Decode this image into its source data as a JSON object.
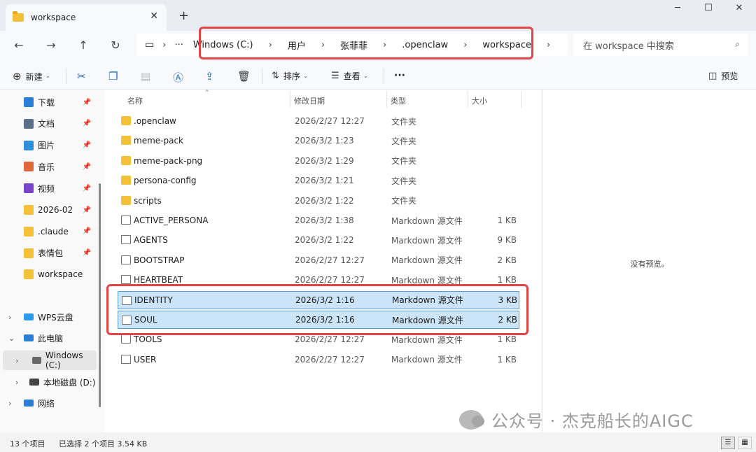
{
  "window": {
    "tab_title": "workspace",
    "controls": {
      "minimize": "─",
      "maximize": "☐",
      "close": "✕"
    },
    "new_tab": "+"
  },
  "address": {
    "segments": [
      "Windows (C:)",
      "用户",
      "张菲菲",
      ".openclaw",
      "workspace"
    ],
    "more": "···",
    "search_placeholder": "在 workspace 中搜索"
  },
  "toolbar": {
    "new_label": "新建",
    "sort_label": "排序",
    "view_label": "查看",
    "more_label": "···",
    "preview_label": "预览"
  },
  "sidebar": {
    "pinned": [
      {
        "label": "下载",
        "icon": "download-icon",
        "color": "#2a7fd4"
      },
      {
        "label": "文档",
        "icon": "document-icon",
        "color": "#5a6f8a"
      },
      {
        "label": "图片",
        "icon": "pictures-icon",
        "color": "#2f8fd8"
      },
      {
        "label": "音乐",
        "icon": "music-icon",
        "color": "#e0663c"
      },
      {
        "label": "视频",
        "icon": "video-icon",
        "color": "#7a44c9"
      },
      {
        "label": "2026-02",
        "icon": "folder-icon",
        "color": "#f4c038"
      },
      {
        "label": ".claude",
        "icon": "folder-icon",
        "color": "#f4c038"
      },
      {
        "label": "表情包",
        "icon": "folder-icon",
        "color": "#f4c038"
      },
      {
        "label": "workspace",
        "icon": "folder-icon",
        "color": "#f4c038"
      }
    ],
    "tree": [
      {
        "label": "WPS云盘",
        "icon": "cloud-icon",
        "color": "#2a9be8"
      },
      {
        "label": "此电脑",
        "icon": "computer-icon",
        "color": "#2a7fd4"
      },
      {
        "label": "Windows (C:)",
        "icon": "drive-icon",
        "color": "#666666"
      },
      {
        "label": "本地磁盘 (D:)",
        "icon": "drive-icon",
        "color": "#444444"
      },
      {
        "label": "网络",
        "icon": "network-icon",
        "color": "#2a7fd4"
      }
    ]
  },
  "columns": {
    "name": "名称",
    "date": "修改日期",
    "type": "类型",
    "size": "大小"
  },
  "files": [
    {
      "name": ".openclaw",
      "date": "2026/2/27 12:27",
      "type": "文件夹",
      "size": "",
      "kind": "folder"
    },
    {
      "name": "meme-pack",
      "date": "2026/3/2 1:23",
      "type": "文件夹",
      "size": "",
      "kind": "folder"
    },
    {
      "name": "meme-pack-png",
      "date": "2026/3/2 1:29",
      "type": "文件夹",
      "size": "",
      "kind": "folder"
    },
    {
      "name": "persona-config",
      "date": "2026/3/2 1:21",
      "type": "文件夹",
      "size": "",
      "kind": "folder"
    },
    {
      "name": "scripts",
      "date": "2026/3/2 1:22",
      "type": "文件夹",
      "size": "",
      "kind": "folder"
    },
    {
      "name": "ACTIVE_PERSONA",
      "date": "2026/3/2 1:38",
      "type": "Markdown 源文件",
      "size": "1 KB",
      "kind": "file"
    },
    {
      "name": "AGENTS",
      "date": "2026/3/2 1:22",
      "type": "Markdown 源文件",
      "size": "9 KB",
      "kind": "file"
    },
    {
      "name": "BOOTSTRAP",
      "date": "2026/2/27 12:27",
      "type": "Markdown 源文件",
      "size": "2 KB",
      "kind": "file"
    },
    {
      "name": "HEARTBEAT",
      "date": "2026/2/27 12:27",
      "type": "Markdown 源文件",
      "size": "1 KB",
      "kind": "file"
    },
    {
      "name": "IDENTITY",
      "date": "2026/3/2 1:16",
      "type": "Markdown 源文件",
      "size": "3 KB",
      "kind": "file",
      "selected": true
    },
    {
      "name": "SOUL",
      "date": "2026/3/2 1:16",
      "type": "Markdown 源文件",
      "size": "2 KB",
      "kind": "file",
      "selected": true
    },
    {
      "name": "TOOLS",
      "date": "2026/2/27 12:27",
      "type": "Markdown 源文件",
      "size": "1 KB",
      "kind": "file"
    },
    {
      "name": "USER",
      "date": "2026/2/27 12:27",
      "type": "Markdown 源文件",
      "size": "1 KB",
      "kind": "file"
    }
  ],
  "preview": {
    "empty_message": "没有预览。"
  },
  "status": {
    "item_count": "13 个项目",
    "selection": "已选择 2 个项目  3.54 KB"
  },
  "watermark": "公众号 · 杰克船长的AIGC",
  "colors": {
    "highlight": "#e34545",
    "selection": "#cce4f7",
    "folder": "#f4c038"
  }
}
